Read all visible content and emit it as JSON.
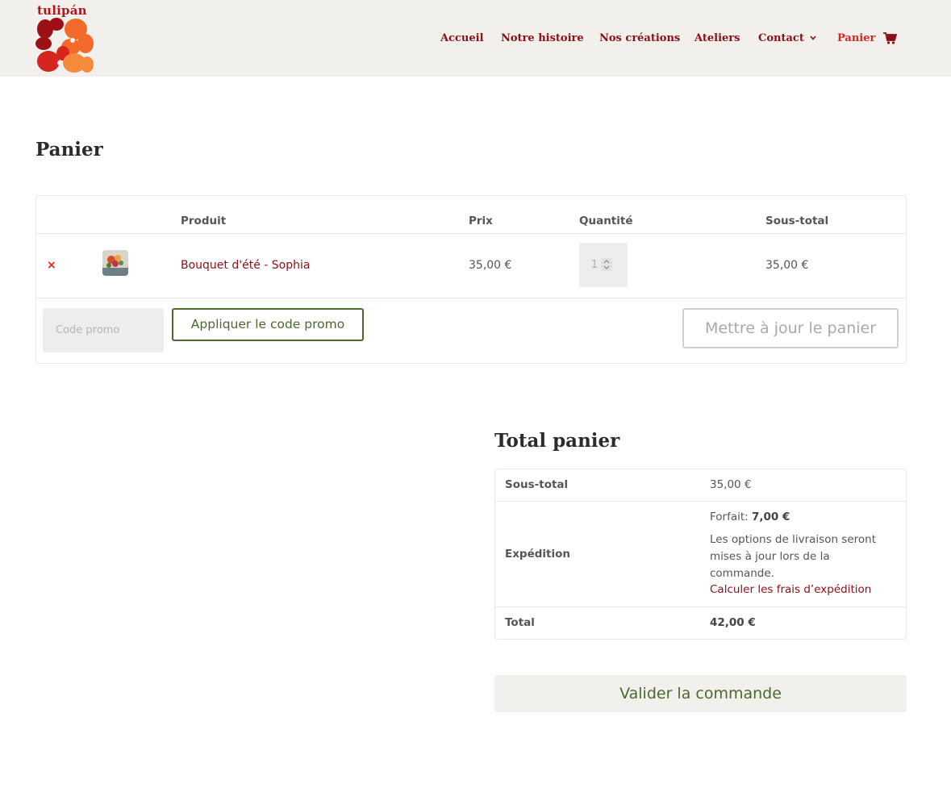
{
  "header": {
    "logo_text": "tulipán",
    "nav": [
      {
        "label": "Accueil"
      },
      {
        "label": "Notre histoire"
      },
      {
        "label": "Nos créations"
      },
      {
        "label": "Ateliers"
      },
      {
        "label": "Contact"
      },
      {
        "label": "Panier",
        "active": true
      }
    ],
    "colors": {
      "nav": "#8b0f16",
      "nav_active": "#d5251f",
      "background": "#f2f0ec"
    }
  },
  "page_title": "Panier",
  "cart": {
    "columns": {
      "product": "Produit",
      "price": "Prix",
      "quantity": "Quantité",
      "subtotal": "Sous-total"
    },
    "items": [
      {
        "remove_icon": "×",
        "name": "Bouquet d'été - Sophia",
        "price": "35,00 €",
        "quantity": "1",
        "subtotal": "35,00 €"
      }
    ],
    "promo_placeholder": "Code promo",
    "apply_label": "Appliquer le code promo",
    "update_label": "Mettre à jour le panier"
  },
  "totals": {
    "title": "Total panier",
    "subtotal_label": "Sous-total",
    "subtotal_value": "35,00 €",
    "shipping_label": "Expédition",
    "shipping_method": "Forfait:",
    "shipping_price": "7,00 €",
    "shipping_note": "Les options de livraison seront mises à jour lors de la commande.",
    "calc_shipping": "Calculer les frais d’expédition",
    "total_label": "Total",
    "total_value": "42,00 €"
  },
  "checkout_label": "Valider la commande"
}
